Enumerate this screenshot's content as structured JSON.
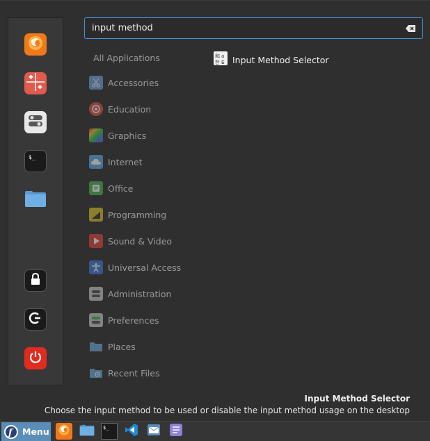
{
  "search": {
    "value": "input method"
  },
  "categories": {
    "all_label": "All Applications",
    "items": [
      {
        "label": "Accessories",
        "icon": "scissors-icon",
        "color": "#6f9fd8"
      },
      {
        "label": "Education",
        "icon": "education-icon",
        "color": "#d9584a"
      },
      {
        "label": "Graphics",
        "icon": "graphics-icon",
        "color": "#c060d0"
      },
      {
        "label": "Internet",
        "icon": "cloud-icon",
        "color": "#5fa8e8"
      },
      {
        "label": "Office",
        "icon": "office-icon",
        "color": "#4caf50"
      },
      {
        "label": "Programming",
        "icon": "programming-icon",
        "color": "#d8c02a"
      },
      {
        "label": "Sound & Video",
        "icon": "play-icon",
        "color": "#e0443a"
      },
      {
        "label": "Universal Access",
        "icon": "accessibility-icon",
        "color": "#3a78d8"
      },
      {
        "label": "Administration",
        "icon": "administration-icon",
        "color": "#c8c8c8"
      },
      {
        "label": "Preferences",
        "icon": "preferences-icon",
        "color": "#c8c8c8"
      },
      {
        "label": "Places",
        "icon": "folder-icon",
        "color": "#6aa9db"
      },
      {
        "label": "Recent Files",
        "icon": "recent-files-icon",
        "color": "#6aa9db"
      }
    ]
  },
  "results": [
    {
      "label": "Input Method Selector",
      "icon": "input-method-icon"
    }
  ],
  "description": {
    "title": "Input Method Selector",
    "text": "Choose the input method to be used or disable the input method usage on the desktop"
  },
  "favorites": [
    {
      "name": "firefox",
      "icon": "firefox-icon",
      "color": "#e66000"
    },
    {
      "name": "software-manager",
      "icon": "software-manager-icon",
      "color": "#e05a4e"
    },
    {
      "name": "settings",
      "icon": "settings-toggle-icon",
      "color": "#e8e8e8"
    },
    {
      "name": "terminal",
      "icon": "terminal-icon",
      "color": "#1e1e1e"
    },
    {
      "name": "files",
      "icon": "folder-icon",
      "color": "#6aa9db"
    },
    {
      "name": "lock-screen",
      "icon": "lock-icon",
      "color": "#1e1e1e"
    },
    {
      "name": "logout",
      "icon": "logout-icon",
      "color": "#1e1e1e"
    },
    {
      "name": "shutdown",
      "icon": "power-icon",
      "color": "#e02b20"
    }
  ],
  "panel": {
    "menu_label": "Menu",
    "menu_color": "#5b8db9",
    "launchers": [
      {
        "name": "firefox",
        "icon": "firefox-icon"
      },
      {
        "name": "files",
        "icon": "folder-icon"
      },
      {
        "name": "terminal",
        "icon": "terminal-icon"
      },
      {
        "name": "vscode",
        "icon": "vscode-icon"
      },
      {
        "name": "mail",
        "icon": "mail-icon"
      },
      {
        "name": "text-editor",
        "icon": "text-editor-icon"
      }
    ]
  }
}
